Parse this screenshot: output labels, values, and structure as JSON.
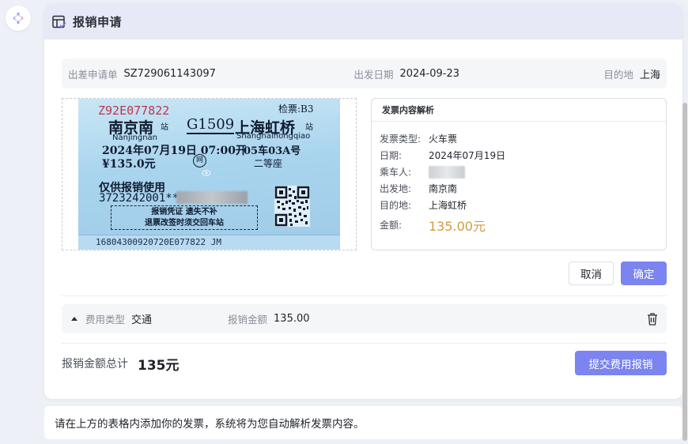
{
  "header": {
    "title": "报销申请"
  },
  "trip": {
    "order_label": "出差申请单",
    "order_value": "SZ729061143097",
    "date_label": "出发日期",
    "date_value": "2024-09-23",
    "dest_label": "目的地",
    "dest_value": "上海"
  },
  "ticket": {
    "ticket_no": "Z92E077822",
    "check": "检票:B3",
    "from": "南京南",
    "from_station_suffix": "站",
    "train": "G1509",
    "to": "上海虹桥",
    "to_station_suffix": "站",
    "from_en": "Nanjingnan",
    "to_en": "Shanghaihongqiao",
    "datetime": "2024年07月19日 07:00开",
    "seat": "05车03A号",
    "price": "¥135.0元",
    "net_mark": "网",
    "seat_class": "二等座",
    "usage": "仅供报销使用",
    "id_prefix": "3723242001****",
    "notice_line1": "报销凭证 遗失不补",
    "notice_line2": "退票改签时须交回车站",
    "serial": "16804300920720E077822 JM"
  },
  "parse": {
    "title": "发票内容解析",
    "rows": [
      {
        "label": "发票类型:",
        "value": "火车票"
      },
      {
        "label": "日期:",
        "value": "2024年07月19日"
      },
      {
        "label": "乘车人:",
        "value": ""
      },
      {
        "label": "出发地:",
        "value": "南京南"
      },
      {
        "label": "目的地:",
        "value": "上海虹桥"
      }
    ],
    "amount_label": "金额:",
    "amount_value": "135.00元"
  },
  "actions": {
    "cancel": "取消",
    "confirm": "确定"
  },
  "fee": {
    "type_label": "费用类型",
    "type_value": "交通",
    "amount_label": "报销金额",
    "amount_value": "135.00"
  },
  "total": {
    "label": "报销金额总计",
    "value": "135元",
    "submit": "提交费用报销"
  },
  "hint": "请在上方的表格内添加你的发票，系统将为您自动解析发票内容。",
  "colors": {
    "primary": "#7b84f0",
    "amount": "#d39a3e",
    "header_bg": "#e8e9f6"
  }
}
